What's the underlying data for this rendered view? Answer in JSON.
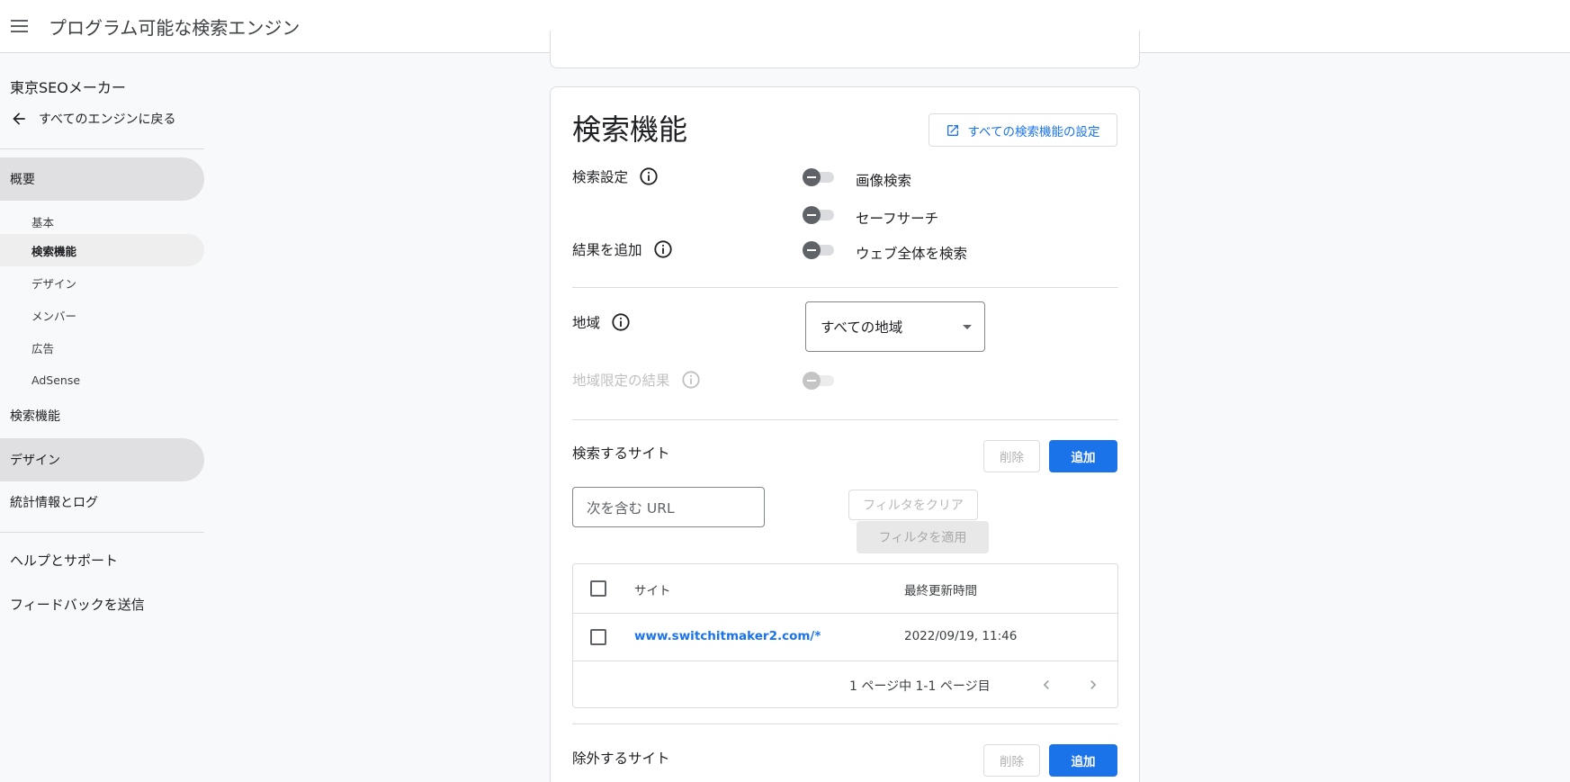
{
  "topbar": {
    "title": "プログラム可能な検索エンジン"
  },
  "sidebar": {
    "engine_name": "東京SEOメーカー",
    "back_label": "すべてのエンジンに戻る",
    "overview": "概要",
    "sub_items": [
      "基本",
      "検索機能",
      "デザイン",
      "メンバー",
      "広告",
      "AdSense"
    ],
    "search_features": "検索機能",
    "design": "デザイン",
    "stats": "統計情報とログ",
    "help": "ヘルプとサポート",
    "feedback": "フィードバックを送信"
  },
  "card": {
    "title": "検索機能",
    "all_settings_label": "すべての検索機能の設定",
    "search_settings_label": "検索設定",
    "add_results_label": "結果を追加",
    "toggles": {
      "image_search": "画像検索",
      "safe_search": "セーフサーチ",
      "web_search": "ウェブ全体を検索"
    },
    "region_label": "地域",
    "region_value": "すべての地域",
    "region_results_label": "地域限定の結果",
    "sites_to_search": {
      "title": "検索するサイト",
      "delete_label": "削除",
      "add_label": "追加",
      "url_placeholder": "次を含む URL",
      "clear_filter_label": "フィルタをクリア",
      "apply_filter_label": "フィルタを適用",
      "columns": [
        "サイト",
        "最終更新時間"
      ],
      "rows": [
        {
          "site": "www.switchitmaker2.com/*",
          "updated": "2022/09/19, 11:46"
        }
      ],
      "pagination": "1 ページ中 1-1 ページ目"
    },
    "sites_to_exclude": {
      "title": "除外するサイト",
      "delete_label": "削除",
      "add_label": "追加"
    }
  }
}
